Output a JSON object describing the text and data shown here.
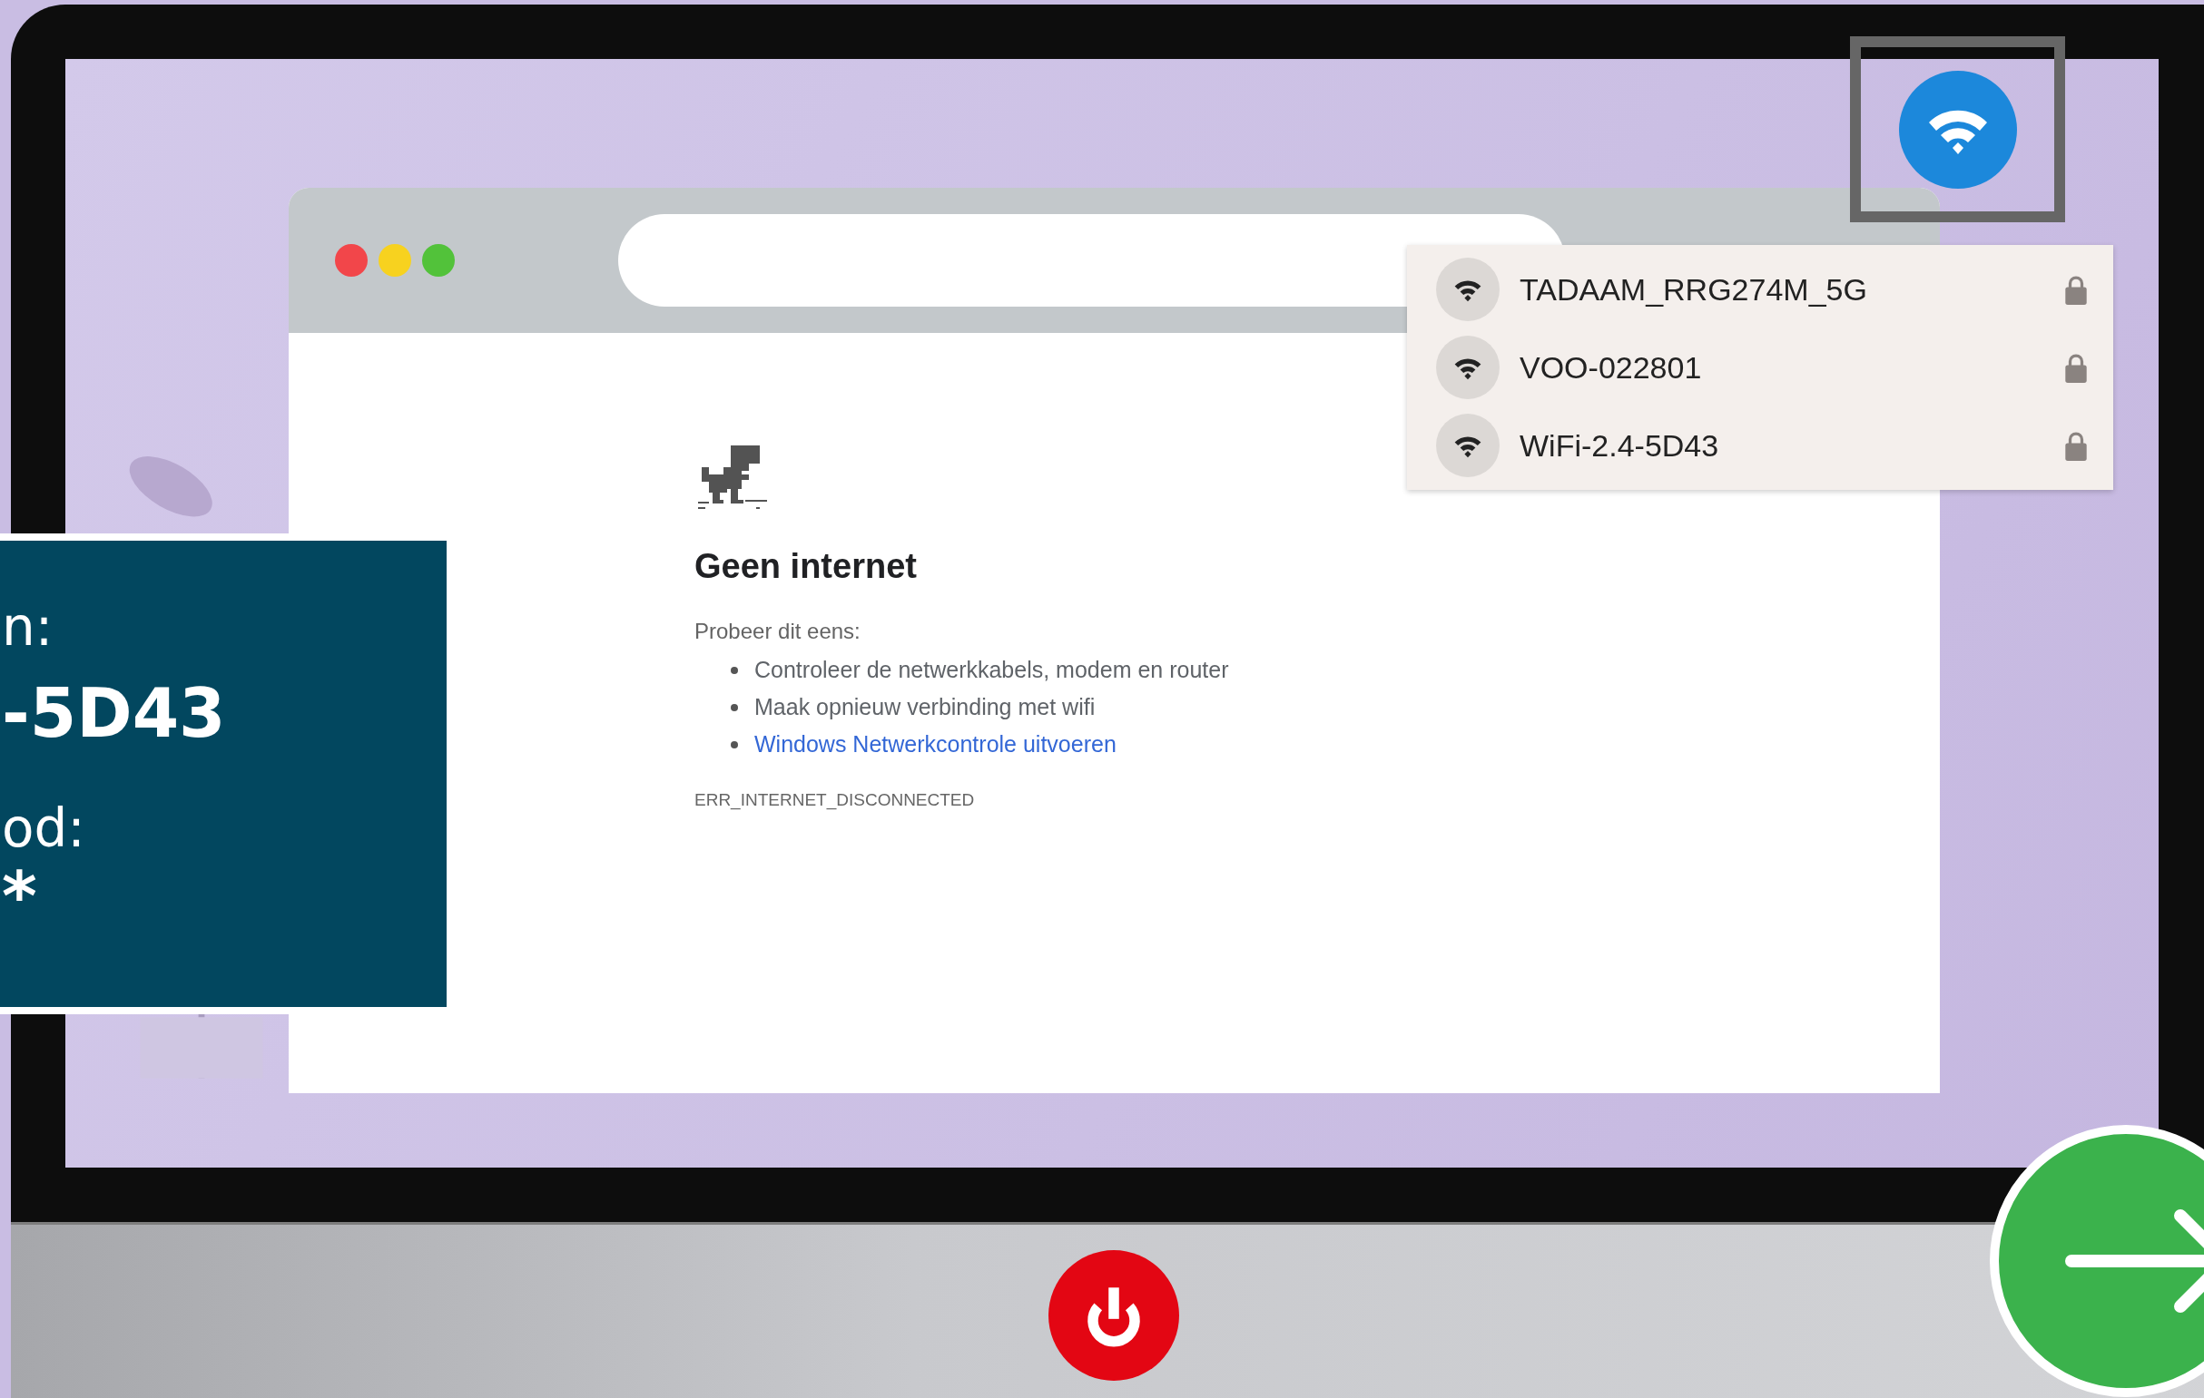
{
  "browser": {
    "window_controls": [
      {
        "color": "#f2464a"
      },
      {
        "color": "#f7d21f"
      },
      {
        "color": "#52c23a"
      }
    ],
    "error_page": {
      "heading": "Geen internet",
      "prompt": "Probeer dit eens:",
      "suggestions": [
        {
          "kind": "text",
          "text": "Controleer de netwerkkabels, modem en router"
        },
        {
          "kind": "text",
          "text": "Maak opnieuw verbinding met wifi"
        },
        {
          "kind": "link",
          "text": "Windows Netwerkcontrole uitvoeren"
        }
      ],
      "error_code": "ERR_INTERNET_DISCONNECTED"
    }
  },
  "wifi_menu": {
    "networks": [
      {
        "name": "TADAAM_RRG274M_5G",
        "locked": true
      },
      {
        "name": "VOO-022801",
        "locked": true
      },
      {
        "name": "WiFi-2.4-5D43",
        "locked": true
      }
    ]
  },
  "info_panel": {
    "lines": [
      {
        "kind": "label",
        "text": "n:"
      },
      {
        "kind": "value",
        "text": "-5D43"
      },
      {
        "kind": "label",
        "text": "od:"
      },
      {
        "kind": "value",
        "text": "*"
      }
    ]
  }
}
